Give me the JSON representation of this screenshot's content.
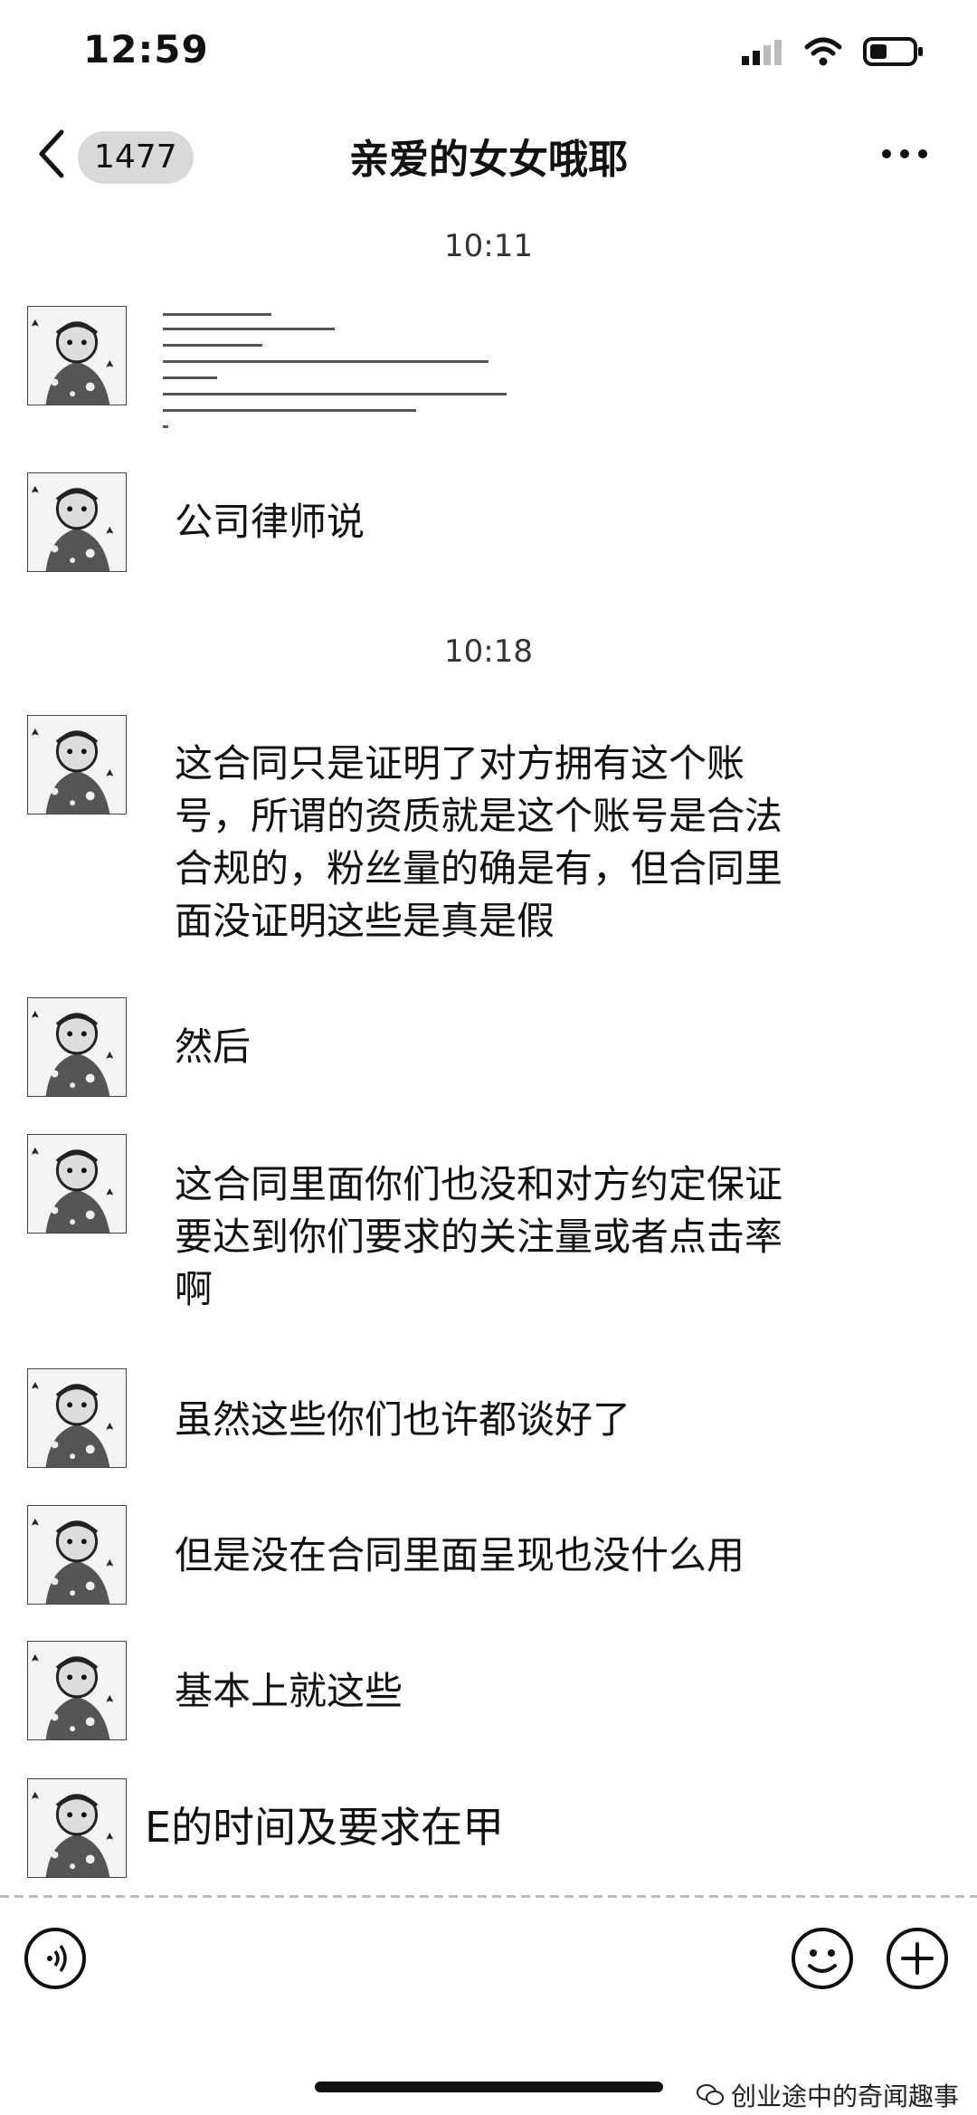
{
  "status_bar": {
    "time": "12:59"
  },
  "nav": {
    "unread_count": "1477",
    "title": "亲爱的女女哦耶"
  },
  "messages": [
    {
      "timestamp": "10:11"
    },
    {
      "type": "image",
      "preview": "document"
    },
    {
      "type": "text",
      "text": "公司律师说"
    },
    {
      "timestamp": "10:18"
    },
    {
      "type": "text",
      "text": "这合同只是证明了对方拥有这个账号，所谓的资质就是这个账号是合法合规的，粉丝量的确是有，但合同里面没证明这些是真是假"
    },
    {
      "type": "text",
      "text": "然后"
    },
    {
      "type": "text",
      "text": "这合同里面你们也没和对方约定保证要达到你们要求的关注量或者点击率啊"
    },
    {
      "type": "text",
      "text": "虽然这些你们也许都谈好了"
    },
    {
      "type": "text",
      "text": "但是没在合同里面呈现也没什么用"
    },
    {
      "type": "text",
      "text": "基本上就这些"
    },
    {
      "type": "text",
      "text": "E的时间及要求在甲"
    }
  ],
  "watermark": "创业途中的奇闻趣事",
  "colors": {
    "background": "#ffffff",
    "text": "#111111",
    "badge": "#d9d9d9"
  }
}
